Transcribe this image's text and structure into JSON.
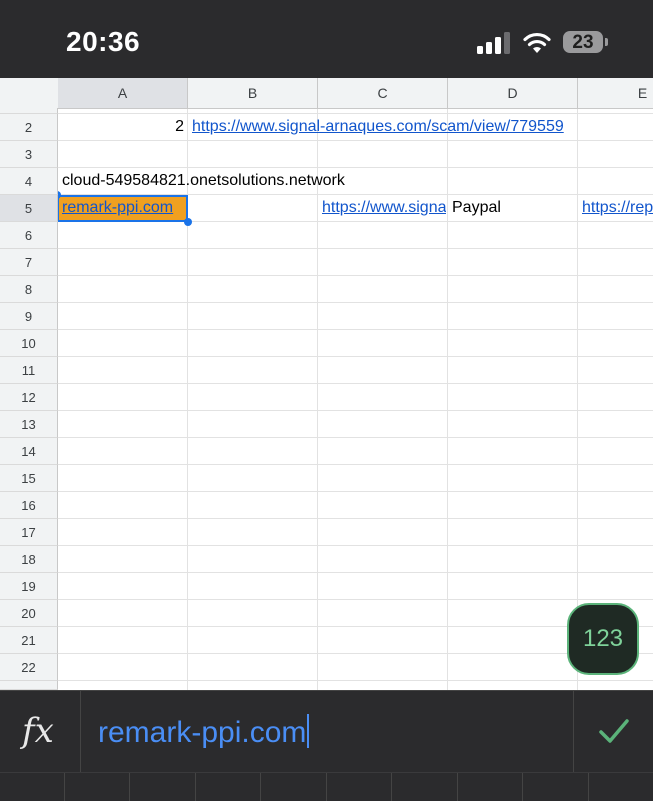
{
  "status_bar": {
    "time": "20:36",
    "battery_level": "23"
  },
  "sheet": {
    "columns": [
      "A",
      "B",
      "C",
      "D",
      "E"
    ],
    "selected_column": "A",
    "rows": [
      "2",
      "3",
      "4",
      "5",
      "6",
      "7",
      "8",
      "9",
      "10",
      "11",
      "12",
      "13",
      "14",
      "15",
      "16",
      "17",
      "18",
      "19",
      "20",
      "21",
      "22"
    ],
    "selected_row": "5",
    "cells": {
      "A2": "2",
      "B2": "https://www.signal-arnaques.com/scam/view/779559",
      "A4": "cloud-549584821.onetsolutions.network",
      "A5": "remark-ppi.com",
      "C5": "https://www.signa",
      "D5": "Paypal",
      "E5": "https://rep"
    },
    "selected_cell": "A5"
  },
  "fab": {
    "label": "123"
  },
  "formula_bar": {
    "fx_label": "fx",
    "value": "remark-ppi.com"
  },
  "colors": {
    "selection": "#1a73e8",
    "cell_fill": "#f0a020",
    "link": "#1155cc",
    "dark_bar": "#2b2b2d",
    "accent_green": "#5bb37a"
  }
}
